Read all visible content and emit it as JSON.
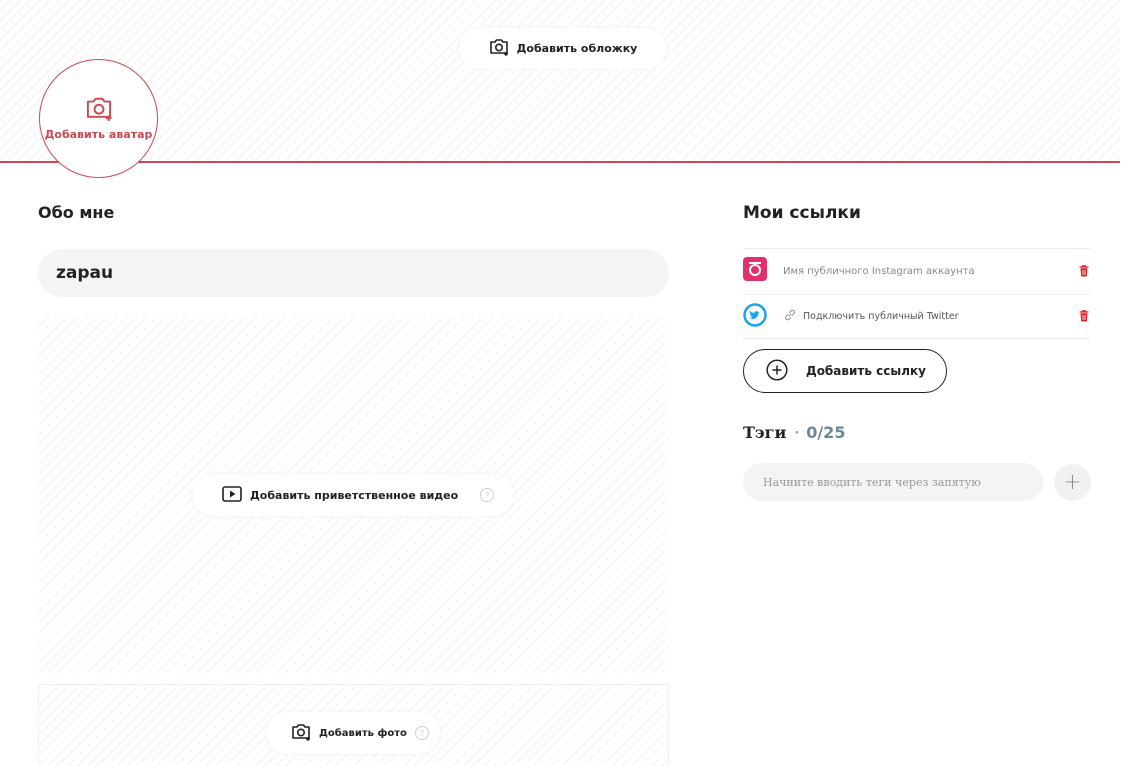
{
  "cover": {
    "add_cover_label": "Добавить обложку",
    "icon": "camera-icon"
  },
  "avatar": {
    "add_avatar_label": "Добавить аватар",
    "icon": "camera-icon"
  },
  "about": {
    "heading": "Обо мне",
    "name_value": "zapau",
    "add_video_label": "Добавить приветственное видео",
    "add_photo_label": "Добавить фото",
    "help_glyph": "?"
  },
  "links": {
    "heading": "Мои ссылки",
    "items": [
      {
        "icon": "instagram-icon",
        "text": "Имя публичного Instagram аккаунта"
      },
      {
        "icon": "twitter-icon",
        "text": "Подключить публичный Twitter"
      }
    ],
    "add_link_label": "Добавить ссылку"
  },
  "tags": {
    "heading": "Тэги",
    "separator": "·",
    "count": "0/25",
    "input_placeholder": "Начните вводить теги через запятую",
    "add_glyph": "+"
  },
  "colors": {
    "accent": "#c94a52",
    "instagram": "#e1306c",
    "twitter": "#1da1f2",
    "tag_count": "#6f8794"
  }
}
